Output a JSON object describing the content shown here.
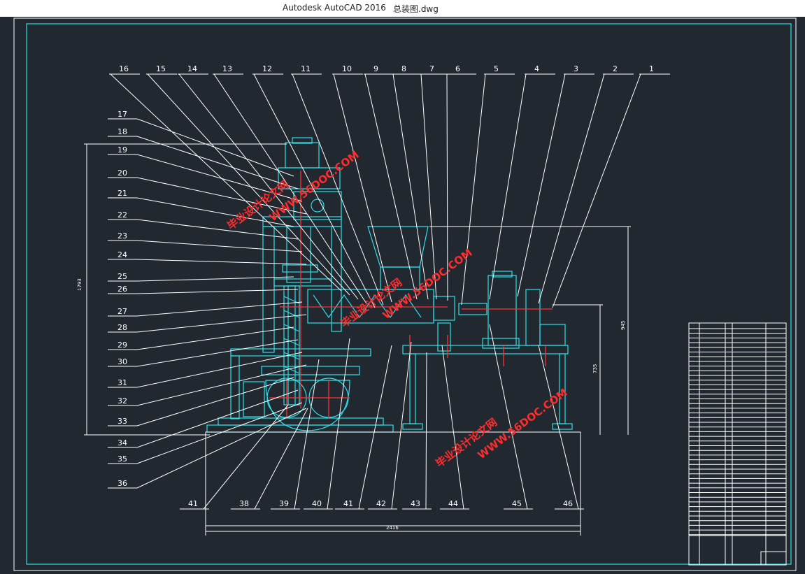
{
  "window": {
    "app_title": "Autodesk AutoCAD 2016",
    "file_name": "总装图.dwg"
  },
  "callouts_top": [
    "16",
    "15",
    "14",
    "13",
    "12",
    "11",
    "10",
    "9",
    "8",
    "7",
    "6",
    "5",
    "4",
    "3",
    "2",
    "1"
  ],
  "callouts_left": [
    "17",
    "18",
    "19",
    "20",
    "21",
    "22",
    "23",
    "24",
    "25",
    "26",
    "27",
    "28",
    "29",
    "30",
    "31",
    "32",
    "33",
    "34",
    "35",
    "36"
  ],
  "callouts_bottom": [
    "41",
    "38",
    "39",
    "40",
    "41",
    "42",
    "43",
    "44",
    "45",
    "46"
  ],
  "dimensions": {
    "total_length": "2416",
    "overall_height": "1793",
    "right_height": "945",
    "right_lower": "735"
  },
  "watermark": {
    "site": "WWW.56DOC.COM",
    "cn": "毕业设计论文网"
  },
  "colors": {
    "background": "#212830",
    "frame": "#2fe0e8",
    "lines": "#ffffff",
    "center": "#ff3333",
    "watermark": "#ff2d2d"
  }
}
